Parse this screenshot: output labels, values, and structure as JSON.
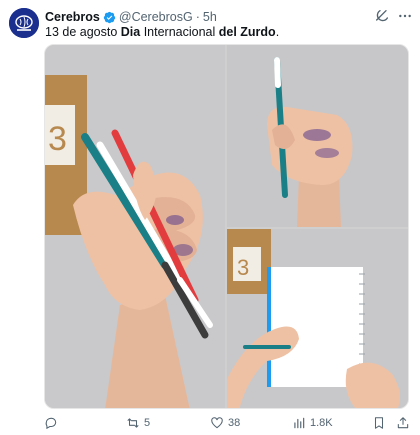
{
  "tweet": {
    "author_name": "Cerebros",
    "handle": "@CerebrosG",
    "separator": "·",
    "time": "5h",
    "text_date": "13 de agosto ",
    "text_bold1": "Dia",
    "text_mid": " Internacional ",
    "text_bold2": "del Zurdo",
    "text_end": "."
  },
  "actions": {
    "replies": "",
    "retweets": "5",
    "likes": "38",
    "views": "1.8K"
  },
  "media": {
    "image1_text": "3",
    "image3_text": "3"
  },
  "colors": {
    "accent": "#1d9bf0",
    "avatar_bg": "#1b2f8f",
    "muted": "#536471",
    "pen_teal": "#1a7f86",
    "pen_red": "#e23c3f",
    "ink_purple": "#5a3d8a"
  },
  "icons": [
    "verified-badge-icon",
    "grok-icon",
    "more-icon",
    "reply-icon",
    "retweet-icon",
    "like-icon",
    "views-icon",
    "bookmark-icon",
    "share-icon"
  ]
}
